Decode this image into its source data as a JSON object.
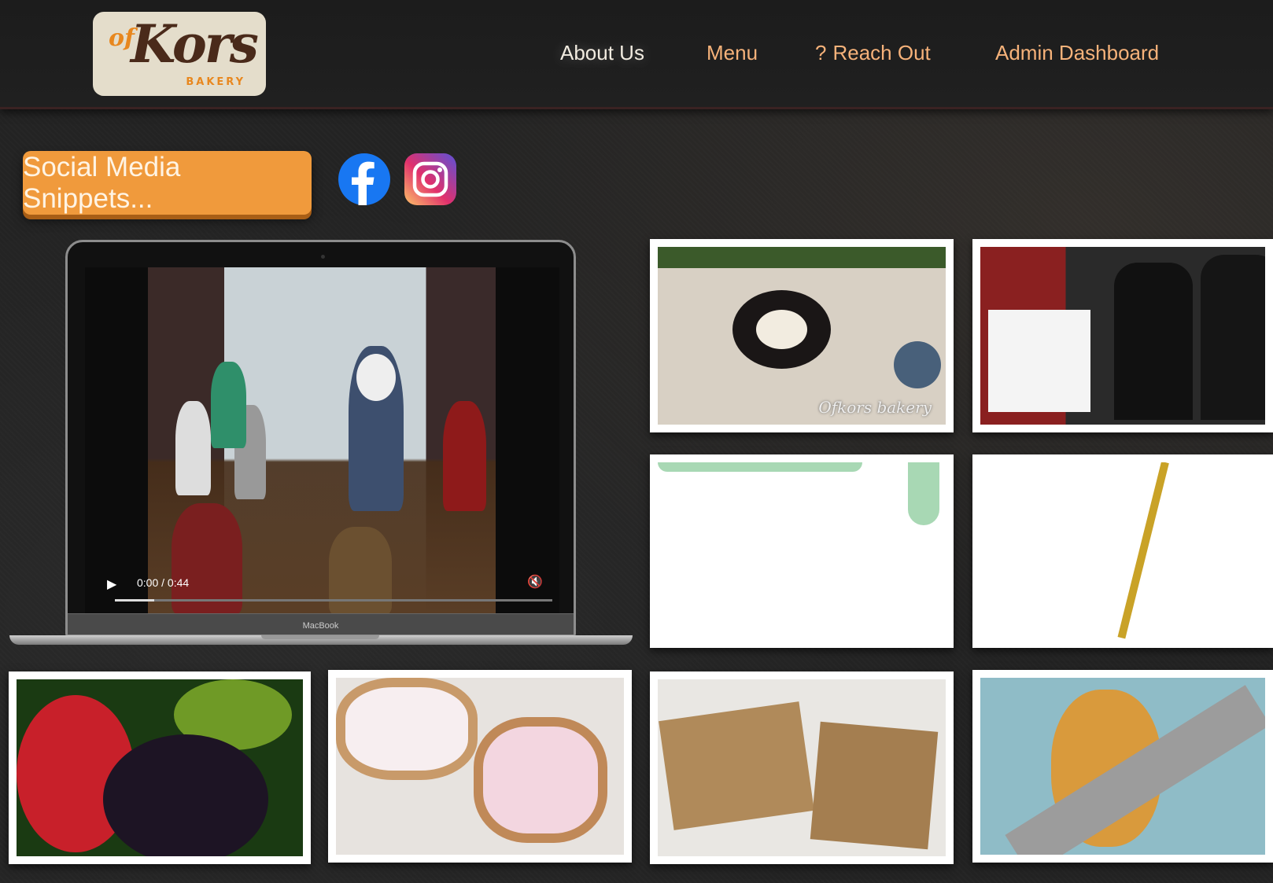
{
  "nav": {
    "about": "About Us",
    "menu": "Menu",
    "reach_out_icon": "?",
    "reach_out": "Reach Out",
    "admin": "Admin Dashboard"
  },
  "logo": {
    "of": "of",
    "kors": "Kors",
    "bakery": "BAKERY"
  },
  "social": {
    "snippets_label": "Social Media Snippets...",
    "facebook_icon": "facebook-icon",
    "instagram_icon": "instagram-icon"
  },
  "video": {
    "time": "0:00 / 0:44",
    "progress_fraction": 0.09,
    "laptop_label": "MacBook",
    "play_glyph": "▶",
    "mute_glyph": "🔇",
    "fullscreen_glyph": "⛶",
    "more_glyph": "⋮"
  },
  "gallery": {
    "roll_caption": "Ofkors bakery"
  }
}
